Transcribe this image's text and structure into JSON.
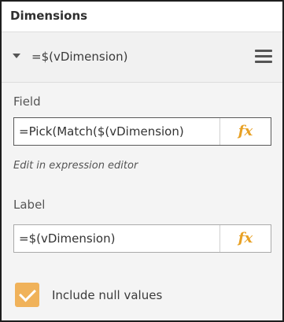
{
  "section": {
    "title": "Dimensions"
  },
  "dimension_item": {
    "title": "=$(vDimension)",
    "caret_icon": "caret-down-icon",
    "menu_icon": "hamburger-menu-icon"
  },
  "field": {
    "label": "Field",
    "value": "=Pick(Match($(vDimension)",
    "fx_label": "fx",
    "edit_link": "Edit in expression editor"
  },
  "label_field": {
    "label": "Label",
    "value": "=$(vDimension)",
    "fx_label": "fx"
  },
  "include_null": {
    "label": "Include null values",
    "checked": true
  },
  "colors": {
    "accent": "#e8a125",
    "checkbox": "#f0b25a",
    "panel_bg": "#f4f4f4"
  }
}
